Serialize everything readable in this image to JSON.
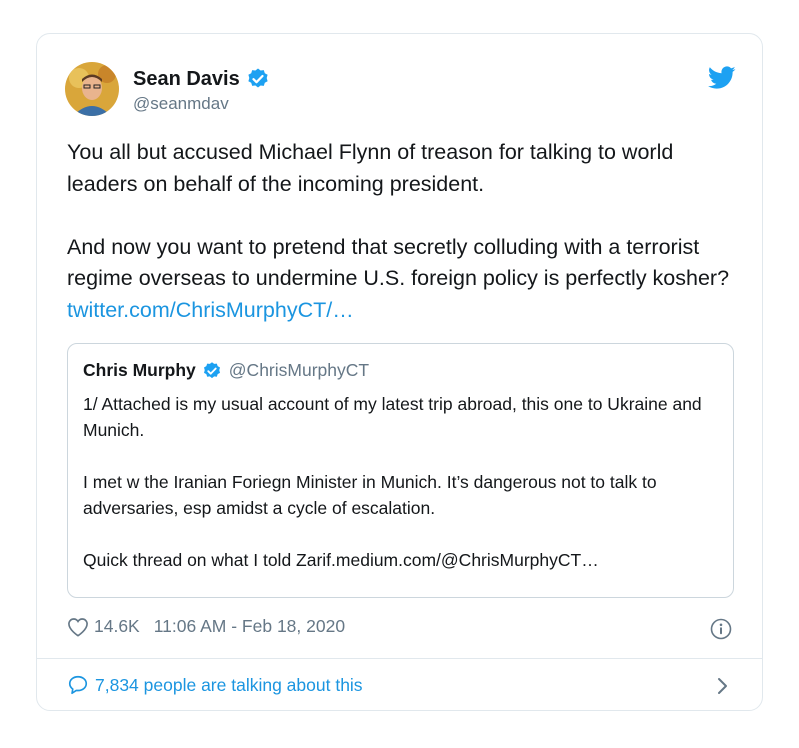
{
  "author": {
    "name": "Sean Davis",
    "handle": "@seanmdav"
  },
  "tweet": {
    "text": "You all but accused Michael Flynn of treason for talking to world leaders on behalf of the incoming president.\n\nAnd now you want to pretend that secretly colluding with a terrorist regime overseas to undermine U.S. foreign policy is perfectly kosher? ",
    "link": "twitter.com/ChrisMurphyCT/…"
  },
  "quoted_tweet": {
    "name": "Chris Murphy",
    "handle": "@ChrisMurphyCT",
    "text": "1/ Attached is my usual account of my latest trip abroad, this one to Ukraine and Munich.\n\nI met w the Iranian Foriegn Minister in Munich. It’s dangerous not to talk to adversaries, esp amidst a cycle of escalation.\n\nQuick thread on what I told Zarif.medium.com/@ChrisMurphyCT…"
  },
  "meta": {
    "likes": "14.6K",
    "timestamp": "11:06 AM - Feb 18, 2020"
  },
  "footer": {
    "conversation": "7,834 people are talking about this"
  },
  "icons": {
    "verified": "verified-badge-icon",
    "brand": "twitter-bird-icon",
    "like": "heart-icon",
    "info": "info-icon",
    "conversation": "speech-bubble-icon",
    "chevron": "chevron-right-icon"
  },
  "colors": {
    "accent": "#1b95e0",
    "verified": "#1da1f2",
    "secondary_text": "#657786",
    "border": "#e1e8ed"
  }
}
